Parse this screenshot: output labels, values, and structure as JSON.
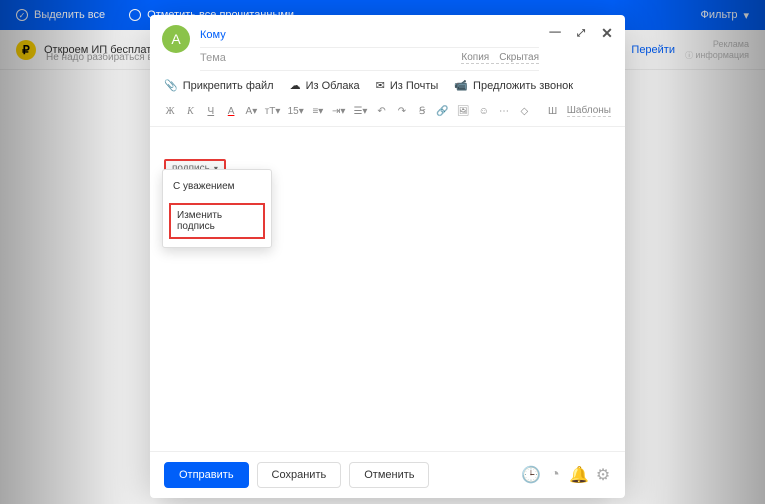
{
  "topbar": {
    "select_all": "Выделить все",
    "mark_read": "Отметить все прочитанными",
    "filter": "Фильтр"
  },
  "ad": {
    "icon_letter": "₽",
    "title": "Откроем ИП бесплатно",
    "sub": "Не надо разбираться в форме",
    "go": "Перейти",
    "reklama1": "Реклама",
    "reklama2": "информация"
  },
  "compose": {
    "avatar": "A",
    "to_label": "Кому",
    "subject_label": "Тема",
    "cc": "Копия",
    "bcc": "Скрытая"
  },
  "attach": {
    "file": "Прикрепить файл",
    "cloud": "Из Облака",
    "mail": "Из Почты",
    "call": "Предложить звонок"
  },
  "toolbar": {
    "fontsize": "15",
    "bullet": "Ш",
    "templates": "Шаблоны"
  },
  "signature": {
    "chip": "подпись",
    "default": "С уважением",
    "edit": "Изменить подпись"
  },
  "footer": {
    "send": "Отправить",
    "save": "Сохранить",
    "cancel": "Отменить"
  }
}
